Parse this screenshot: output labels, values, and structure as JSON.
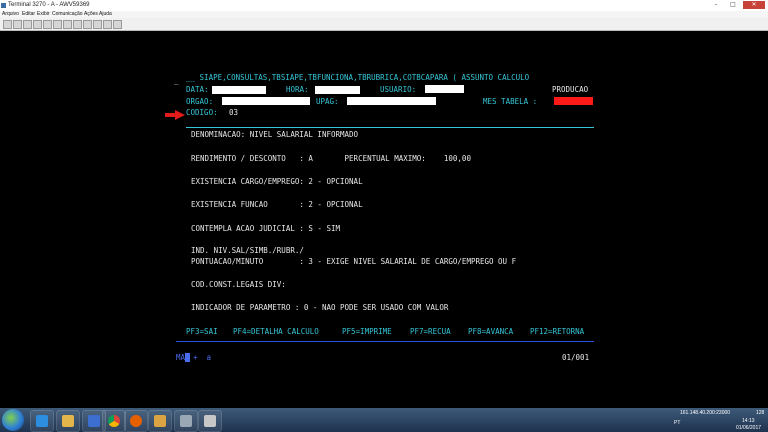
{
  "window": {
    "title": "Terminal 3270 - A - AWV59369",
    "tabs": [
      "",
      "",
      "",
      "",
      "",
      ""
    ],
    "buttons": {
      "minimize": "–",
      "maximize": "□",
      "close": "✕"
    }
  },
  "menu": [
    "Arquivo",
    "Editar",
    "Exibir",
    "Comunicação",
    "Ações",
    "Ajuda"
  ],
  "screen": {
    "marker": "_",
    "header_path": "__ SIAPE,CONSULTAS,TBSIAPE,TBFUNCIONA,TBRUBRICA,COTBCAPARA ( ASSUNTO CALCULO",
    "data_label": "DATA:",
    "hora_label": "HORA:",
    "usuario_label": "USUARIO:",
    "env": "PRODUCAO",
    "orgao_label": "ORGAO:",
    "upag_label": "UPAG:",
    "mes_tabela_label": "MES TABELA :",
    "codigo_label": "CODIGO:",
    "codigo_value": "03",
    "lines": {
      "denominacao": "DENOMINACAO: NIVEL SALARIAL INFORMADO",
      "rendimento": "RENDIMENTO / DESCONTO   : A       PERCENTUAL MAXIMO:    100,00",
      "existencia_cargo": "EXISTENCIA CARGO/EMPREGO: 2 - OPCIONAL",
      "existencia_funcao": "EXISTENCIA FUNCAO       : 2 - OPCIONAL",
      "acao_judicial": "CONTEMPLA ACAO JUDICIAL : S - SIM",
      "ind_niv": "IND. NIV.SAL/SIMB./RUBR./",
      "pontuacao": "PONTUACAO/MINUTO        : 3 - EXIGE NIVEL SALARIAL DE CARGO/EMPREGO OU F",
      "cod_const": "COD.CONST.LEGAIS DIV:",
      "indicador": "INDICADOR DE PARAMETRO : 0 - NAO PODE SER USADO COM VALOR"
    },
    "pf_keys": [
      "PF3=SAI",
      "PF4=DETALHA CALCULO",
      "PF5=IMPRIME",
      "PF7=RECUA",
      "PF8=AVANCA",
      "PF12=RETORNA"
    ],
    "status_left": "MA",
    "status_mid": "+  a",
    "page": "01/001"
  },
  "taskbar": {
    "icons": [
      "ie-icon",
      "explorer-icon",
      "media-icon",
      "chrome-icon",
      "firefox-icon",
      "paint-icon",
      "terminal-icon",
      "word-icon",
      "pdf-icon"
    ],
    "tray_ip": "161.148.40.200:23000",
    "tray_num": "128",
    "tray_lang": "PT",
    "time": "14:13",
    "date": "01/06/2017"
  },
  "colors": {
    "terminal_bg": "#000000",
    "field_cyan": "#35c7d8",
    "text_white": "#e8e8e8",
    "status_blue": "#4a6df0",
    "arrow_red": "#e31b1b",
    "mask_red": "#ff1a1a"
  }
}
